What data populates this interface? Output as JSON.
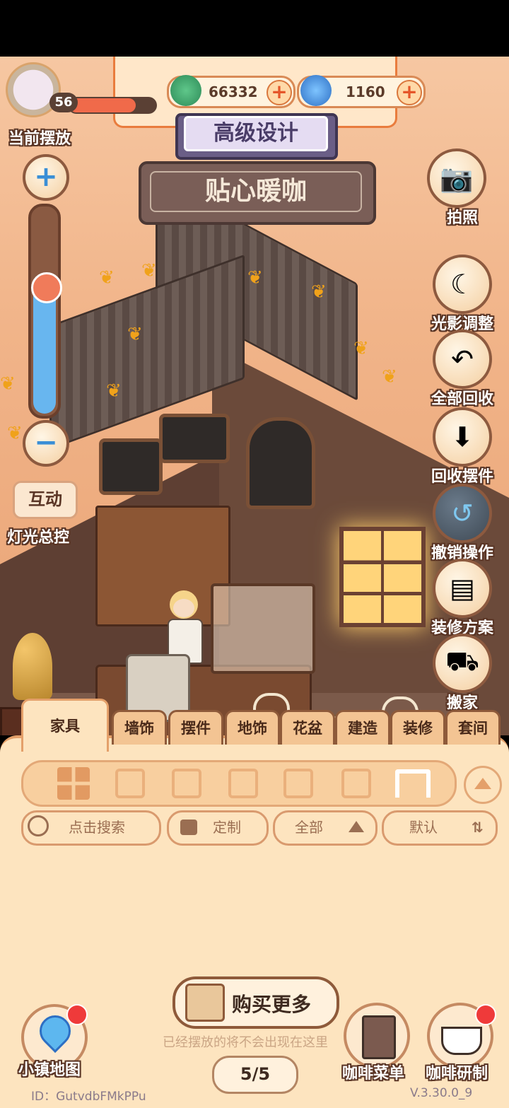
{
  "resources": {
    "clover_count": "66332",
    "gem_count": "1160"
  },
  "player": {
    "level": "56",
    "hp_fraction": 0.78,
    "current_label": "当前摆放"
  },
  "design_button": "高级设计",
  "shop_sign": "贴心暖咖",
  "left_controls": {
    "zoom_level": 0.65,
    "interact_label": "互动",
    "light_label": "灯光总控"
  },
  "right_menu": [
    {
      "label": "拍照",
      "icon": "camera-icon"
    },
    {
      "label": "光影调整",
      "icon": "sun-moon-icon"
    },
    {
      "label": "全部回收",
      "icon": "recycle-all-icon"
    },
    {
      "label": "回收摆件",
      "icon": "recycle-box-icon"
    },
    {
      "label": "撤销操作",
      "icon": "undo-icon"
    },
    {
      "label": "装修方案",
      "icon": "plan-icon"
    },
    {
      "label": "搬家",
      "icon": "truck-icon"
    }
  ],
  "tabs": [
    "家具",
    "墙饰",
    "摆件",
    "地饰",
    "花盆",
    "建造",
    "装修",
    "套间"
  ],
  "categories": [
    "grid-icon",
    "fridge-icon",
    "toilet-icon",
    "stool-icon",
    "bed-icon",
    "cabinet-icon",
    "table-icon"
  ],
  "filters": {
    "search_placeholder": "点击搜索",
    "custom_label": "定制",
    "all_label": "全部",
    "sort_label": "默认"
  },
  "buy_more": "购买更多",
  "placed_note": "已经摆放的将不会出现在这里",
  "pagination": "5/5",
  "bottom_nav": {
    "map": "小镇地图",
    "menu": "咖啡菜单",
    "research": "咖啡研制"
  },
  "footer": {
    "id": "ID：GutvdbFMkPPu",
    "version": "V.3.30.0_9"
  },
  "colors": {
    "accent": "#e97c3d",
    "panel_bg": "#fde4bf",
    "sign_bg": "#7a5e57"
  }
}
